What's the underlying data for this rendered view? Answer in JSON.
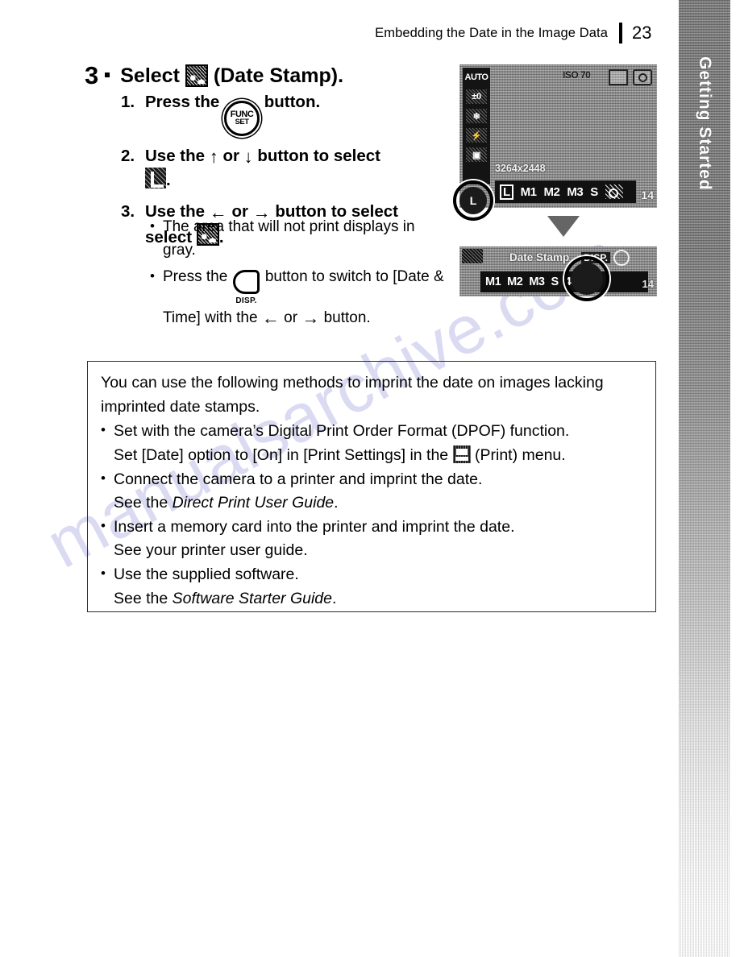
{
  "header": {
    "title": "Embedding the Date in the Image Data",
    "page_number": "23"
  },
  "side_tab": {
    "label": "Getting Started"
  },
  "watermark": {
    "text": "manualsarchive.com"
  },
  "step": {
    "number": "3",
    "title_before_icon": "Select",
    "icon_name": "date-stamp-icon",
    "title_after_icon": "(Date Stamp).",
    "substeps": [
      {
        "number": "1.",
        "text_before": "Press the",
        "icon": "func-set-button-icon",
        "text_after": "button."
      },
      {
        "number": "2.",
        "text_before": "Use the",
        "arrow_first": "↑",
        "text_middle": "or",
        "arrow_second": "↓",
        "text_after": "button to select",
        "trailing_icon": "large-image-size-icon",
        "trailing_text": "."
      },
      {
        "number": "3.",
        "text_before": "Use the",
        "arrow_first": "←",
        "text_middle": "or",
        "arrow_second": "→",
        "text_after": "button to select",
        "trailing_icon": "date-stamp-icon",
        "trailing_text": "."
      }
    ],
    "bullets": [
      {
        "bullet": "•",
        "text": "The area that will not print displays in gray."
      },
      {
        "bullet": "•",
        "text_part1": "Press the",
        "icon": "disp-button-icon",
        "icon_label": "DISP.",
        "text_part2": "button to switch to [Date & Time] with the",
        "arrow_first": "←",
        "text_part3": "or",
        "arrow_second": "→",
        "text_part4": "button."
      }
    ]
  },
  "notes_box": {
    "intro": "You can use the following methods to imprint the date on images lacking imprinted date stamps.",
    "items": [
      {
        "bullet": "•",
        "line1": "Set with the camera’s Digital Print Order Format (DPOF) function.",
        "line2_part1": "Set [Date] option to [On] in [Print Settings] in the",
        "line2_icon": "print-menu-icon",
        "line2_part2": "(Print) menu.",
        "sub": ""
      },
      {
        "bullet": "•",
        "line1": "Connect the camera to a printer and imprint the date.",
        "sub_prefix": "See the",
        "sub_italic": "Direct Print User Guide",
        "sub_suffix": "."
      },
      {
        "bullet": "•",
        "line1": "Insert a memory card into the printer and imprint the date.",
        "sub_plain": "See your printer user guide."
      },
      {
        "bullet": "•",
        "line1": "Use the supplied software.",
        "sub_prefix": "See the",
        "sub_italic": "Software Starter Guide",
        "sub_suffix": "."
      }
    ]
  },
  "lcd_screen_1": {
    "left_column_items": [
      "AUTO",
      "±0",
      "❄",
      "⚡",
      "▣"
    ],
    "iso_indicator": "ISO 70",
    "resolution_label": "3264x2448",
    "options": [
      "L",
      "M1",
      "M2",
      "M3",
      "S",
      "stamp-icon"
    ],
    "selected_option": "L",
    "frame_count": "14",
    "highlight_label": "L"
  },
  "lcd_screen_2": {
    "title": "Date Stamp",
    "disp_tag": "DISP.",
    "options": [
      "M1",
      "M2",
      "M3",
      "S"
    ],
    "selected_icon": "date-stamp-icon",
    "frame_count": "14",
    "extra_label": "4"
  }
}
